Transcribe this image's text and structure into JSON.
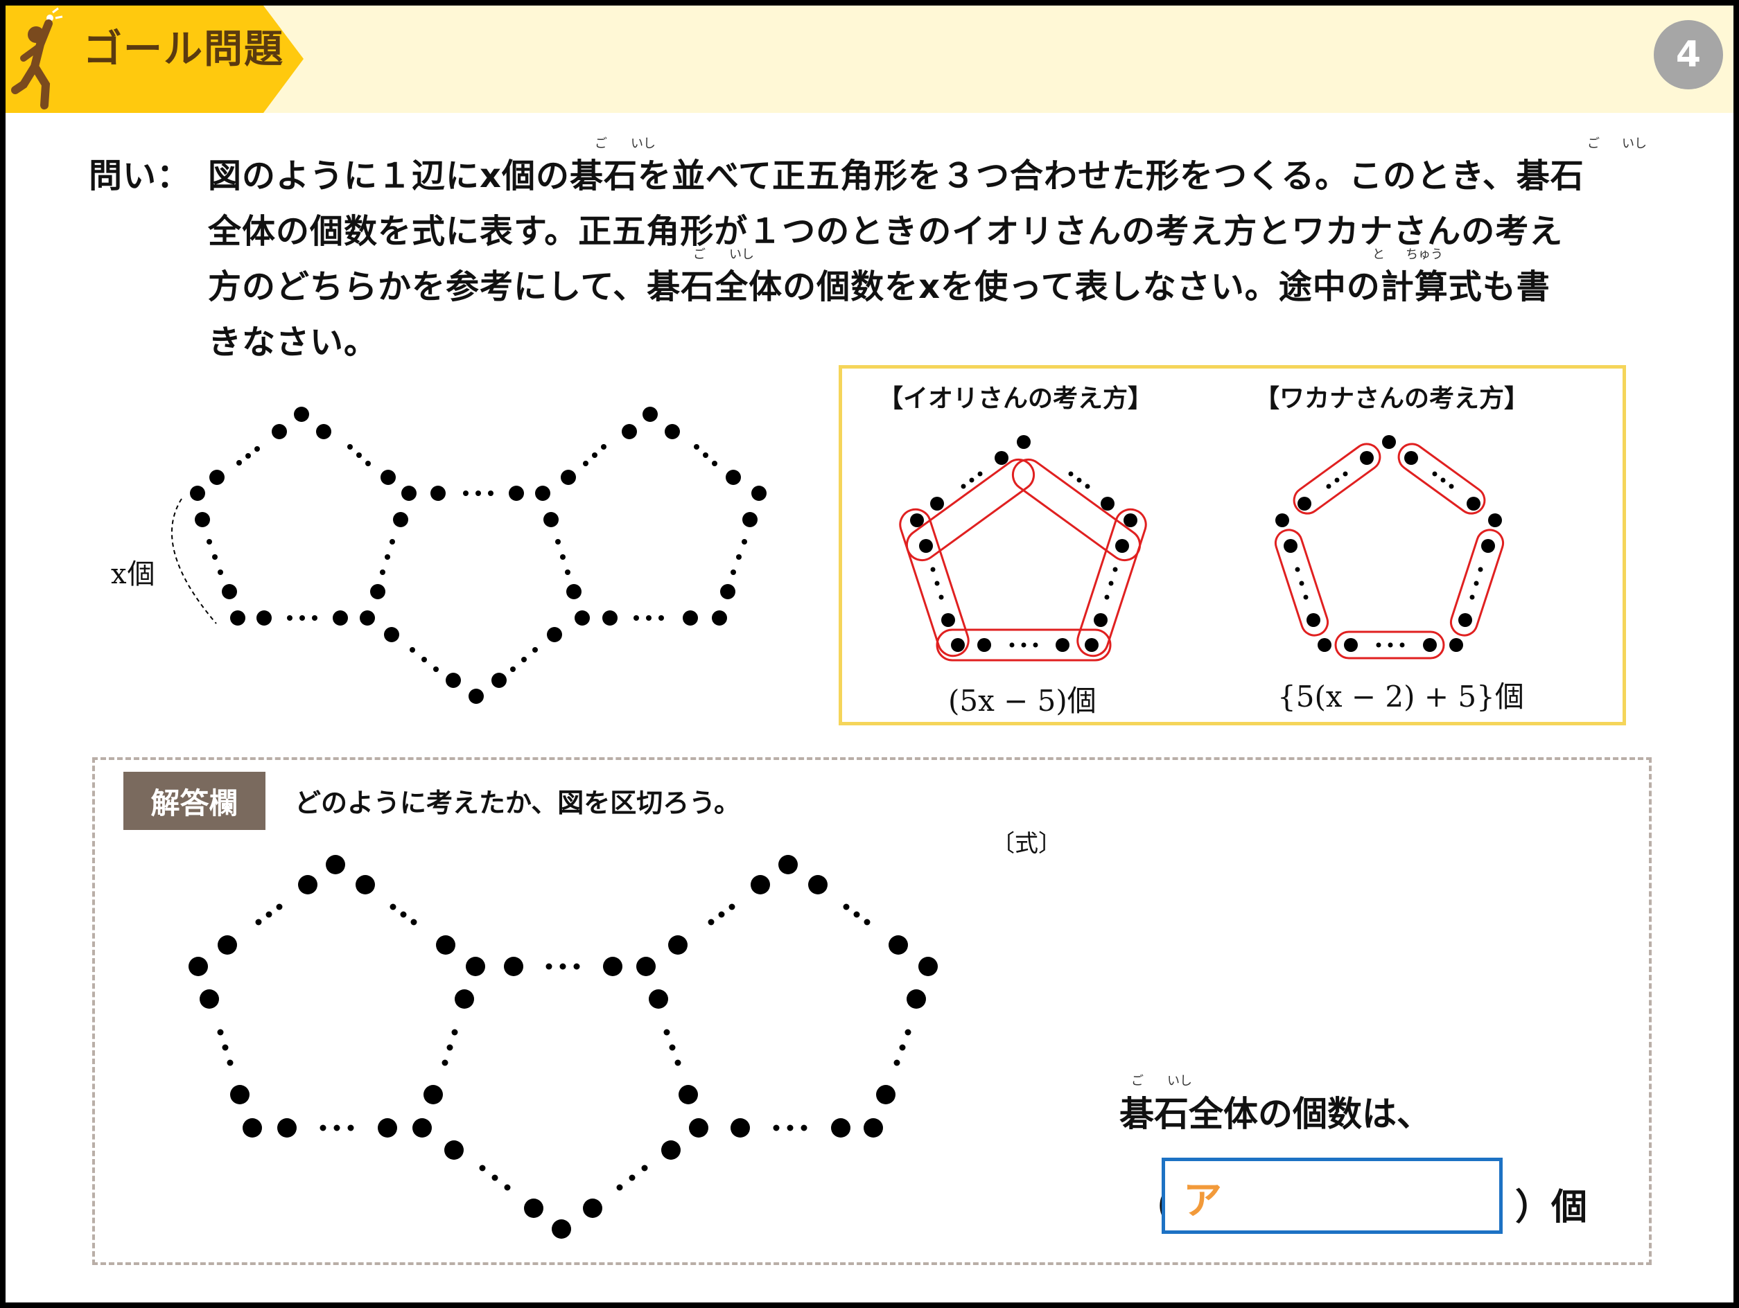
{
  "header": {
    "title": "ゴール問題",
    "page_number": "4",
    "icon": "person-reaching-goal-icon"
  },
  "question": {
    "label": "問い：",
    "line1": "図のように１辺にx個の碁石を並べて正五角形を３つ合わせた形をつくる。このとき、碁石",
    "line2": "全体の個数を式に表す。正五角形が１つのときのイオリさんの考え方とワカナさんの考え",
    "line3": "方のどちらかを参考にして、碁石全体の個数をxを使って表しなさい。途中の計算式も書",
    "line4": "きなさい。",
    "ruby_go": "ご",
    "ruby_ishi": "いし",
    "ruby_to": "と",
    "ruby_chuu": "ちゅう"
  },
  "figure": {
    "side_label": "x個",
    "dots_symbol": "…"
  },
  "methods": {
    "iori": {
      "title": "【イオリさんの考え方】",
      "expression": "(5x − 5)個"
    },
    "wakana": {
      "title": "【ワカナさんの考え方】",
      "expression": "{5(x − 2) + 5}個"
    }
  },
  "answer": {
    "label": "解答欄",
    "instruction": "どのように考えたか、図を区切ろう。",
    "formula_label": "〔式〕",
    "total_text": "碁石全体の個数は、",
    "ruby_go": "ご",
    "ruby_ishi": "いし",
    "paren_open": "（",
    "field_label": "ア",
    "paren_close": "）個"
  },
  "colors": {
    "header_bg": "#fff8d6",
    "tab": "#ffc90e",
    "method_border": "#f5d55a",
    "highlight": "#e02020",
    "answer_label_bg": "#7a6a5e",
    "answer_field_border": "#1d72c4",
    "answer_field_text": "#f29a3a"
  }
}
